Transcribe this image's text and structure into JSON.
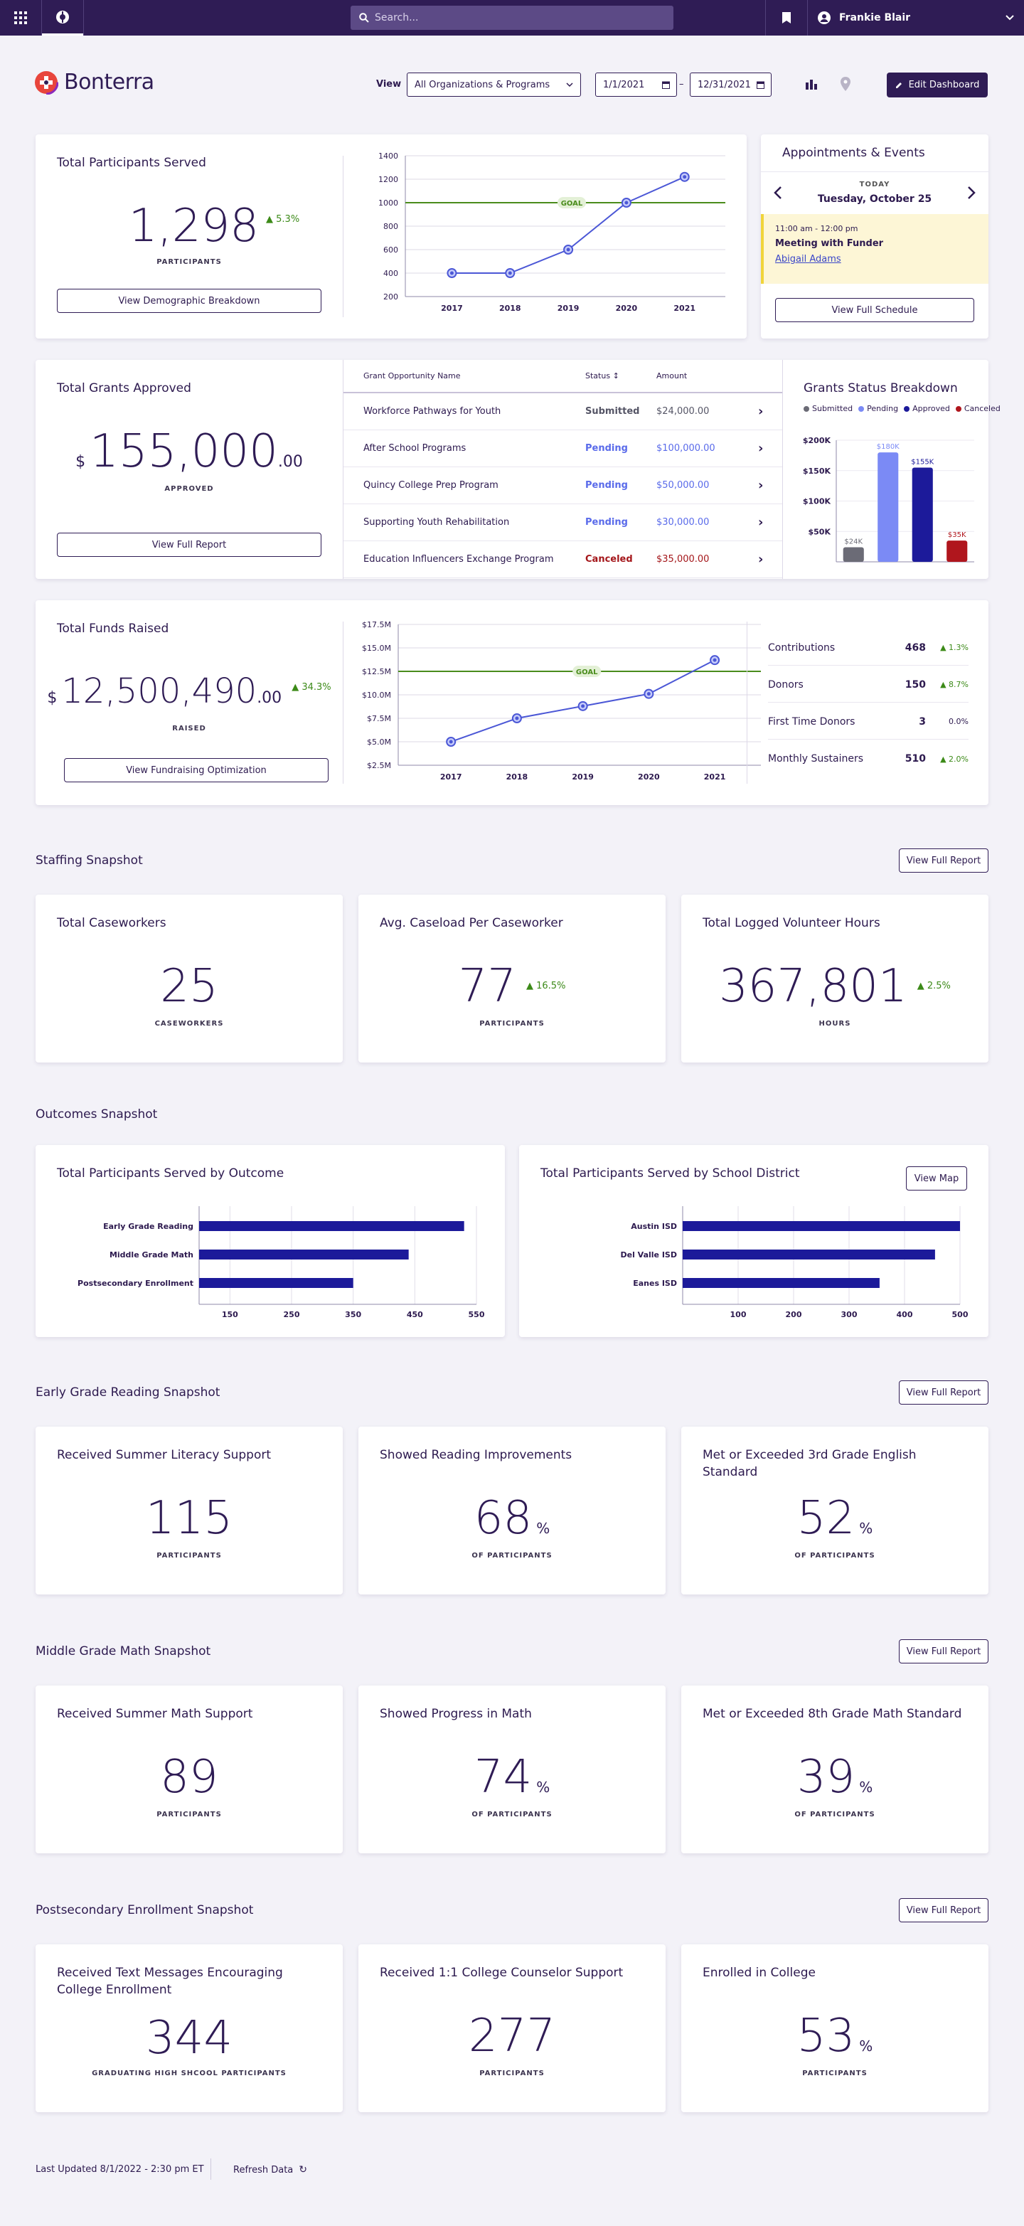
{
  "topbar": {
    "search_placeholder": "Search...",
    "user_name": "Frankie Blair"
  },
  "header": {
    "brand": "Bonterra",
    "view_label": "View",
    "view_value": "All Organizations & Programs",
    "date_from": "1/1/2021",
    "date_to": "12/31/2021",
    "date_sep": "–",
    "edit_label": "Edit Dashboard"
  },
  "participants": {
    "title": "Total Participants Served",
    "value": "1,298",
    "delta": "5.3%",
    "caption": "PARTICIPANTS",
    "button": "View Demographic Breakdown",
    "chart_data": {
      "type": "line",
      "x": [
        "2017",
        "2018",
        "2019",
        "2020",
        "2021"
      ],
      "values": [
        400,
        400,
        600,
        1000,
        1220
      ],
      "goal": 1000,
      "goal_label": "GOAL",
      "ylim": [
        200,
        1400
      ],
      "yticks": [
        "200",
        "400",
        "600",
        "800",
        "1000",
        "1200",
        "1400"
      ],
      "color": "#4b57d6",
      "goal_color": "#4a8c1c"
    }
  },
  "appointments": {
    "title": "Appointments & Events",
    "day_label": "TODAY",
    "date": "Tuesday, October 25",
    "time": "11:00 am - 12:00 pm",
    "event": "Meeting with Funder",
    "person": "Abigail Adams",
    "button": "View Full Schedule"
  },
  "grants": {
    "title": "Total Grants Approved",
    "currency": "$",
    "value": "155,000",
    "cents": ".00",
    "caption": "APPROVED",
    "button": "View Full Report",
    "columns": {
      "name": "Grant Opportunity Name",
      "status": "Status",
      "amount": "Amount"
    },
    "rows": [
      {
        "name": "Workforce Pathways for Youth",
        "status": "Submitted",
        "amount": "$24,000.00",
        "color": "#555566"
      },
      {
        "name": "After School Programs",
        "status": "Pending",
        "amount": "$100,000.00",
        "color": "#5a6bea"
      },
      {
        "name": "Quincy College Prep Program",
        "status": "Pending",
        "amount": "$50,000.00",
        "color": "#5a6bea"
      },
      {
        "name": "Supporting Youth Rehabilitation",
        "status": "Pending",
        "amount": "$30,000.00",
        "color": "#5a6bea"
      },
      {
        "name": "Education Influencers Exchange Program",
        "status": "Canceled",
        "amount": "$35,000.00",
        "color": "#a4161a"
      }
    ]
  },
  "grants_breakdown": {
    "title": "Grants Status Breakdown",
    "chart_data": {
      "type": "bar",
      "categories": [
        "Submitted",
        "Pending",
        "Approved",
        "Canceled"
      ],
      "values": [
        24,
        180,
        155,
        35
      ],
      "labels": [
        "$24K",
        "$180K",
        "$155K",
        "$35K"
      ],
      "colors": [
        "#6b6b76",
        "#7b8af5",
        "#1c1a9a",
        "#b0161d"
      ],
      "ylim": [
        0,
        200
      ],
      "yticks": [
        "$50K",
        "$100K",
        "$150K",
        "$200K"
      ]
    }
  },
  "funds": {
    "title": "Total Funds Raised",
    "currency": "$",
    "value": "12,500,490",
    "cents": ".00",
    "delta": "34.3%",
    "caption": "RAISED",
    "button": "View Fundraising Optimization",
    "chart_data": {
      "type": "line",
      "x": [
        "2017",
        "2018",
        "2019",
        "2020",
        "2021"
      ],
      "values": [
        5.0,
        7.5,
        8.8,
        10.1,
        13.7
      ],
      "goal": 12.5,
      "goal_label": "GOAL",
      "ylim": [
        2.5,
        17.5
      ],
      "yticks": [
        "$2.5M",
        "$5.0M",
        "$7.5M",
        "$10.0M",
        "$12.5M",
        "$15.0M",
        "$17.5M"
      ],
      "color": "#4b57d6",
      "goal_color": "#4a8c1c"
    },
    "metrics": [
      {
        "label": "Contributions",
        "value": "468",
        "delta": "1.3%",
        "up": true
      },
      {
        "label": "Donors",
        "value": "150",
        "delta": "8.7%",
        "up": true
      },
      {
        "label": "First Time Donors",
        "value": "3",
        "delta": "0.0%",
        "up": false
      },
      {
        "label": "Monthly Sustainers",
        "value": "510",
        "delta": "2.0%",
        "up": true
      }
    ]
  },
  "staffing": {
    "title": "Staffing Snapshot",
    "button": "View Full Report",
    "cards": [
      {
        "title": "Total Caseworkers",
        "value": "25",
        "caption": "CASEWORKERS",
        "delta": ""
      },
      {
        "title": "Avg. Caseload Per Caseworker",
        "value": "77",
        "caption": "PARTICIPANTS",
        "delta": "16.5%"
      },
      {
        "title": "Total Logged Volunteer Hours",
        "value": "367,801",
        "caption": "HOURS",
        "delta": "2.5%"
      }
    ]
  },
  "outcomes": {
    "title": "Outcomes Snapshot",
    "by_outcome": {
      "title": "Total Participants Served by Outcome",
      "chart_data": {
        "type": "bar",
        "orientation": "horizontal",
        "categories": [
          "Early Grade Reading",
          "Middle Grade Math",
          "Postsecondary Enrollment"
        ],
        "values": [
          530,
          440,
          350
        ],
        "xlim": [
          100,
          550
        ],
        "xticks": [
          "150",
          "250",
          "350",
          "450",
          "550"
        ],
        "color": "#1c1a9a"
      }
    },
    "by_district": {
      "title": "Total Participants Served by School District",
      "button": "View Map",
      "chart_data": {
        "type": "bar",
        "orientation": "horizontal",
        "categories": [
          "Austin ISD",
          "Del Valle ISD",
          "Eanes ISD"
        ],
        "values": [
          500,
          455,
          355
        ],
        "xlim": [
          0,
          500
        ],
        "xticks": [
          "100",
          "200",
          "300",
          "400",
          "500"
        ],
        "color": "#1c1a9a"
      }
    }
  },
  "reading": {
    "title": "Early Grade Reading Snapshot",
    "button": "View Full Report",
    "cards": [
      {
        "title": "Received Summer Literacy Support",
        "value": "115",
        "unit": "",
        "caption": "PARTICIPANTS"
      },
      {
        "title": "Showed Reading Improvements",
        "value": "68",
        "unit": "%",
        "caption": "OF PARTICIPANTS"
      },
      {
        "title": "Met or Exceeded 3rd Grade English Standard",
        "value": "52",
        "unit": "%",
        "caption": "OF PARTICIPANTS"
      }
    ]
  },
  "math": {
    "title": "Middle Grade Math Snapshot",
    "button": "View Full Report",
    "cards": [
      {
        "title": "Received Summer Math Support",
        "value": "89",
        "unit": "",
        "caption": "PARTICIPANTS"
      },
      {
        "title": "Showed Progress in Math",
        "value": "74",
        "unit": "%",
        "caption": "OF PARTICIPANTS"
      },
      {
        "title": "Met or Exceeded 8th Grade Math Standard",
        "value": "39",
        "unit": "%",
        "caption": "OF PARTICIPANTS"
      }
    ]
  },
  "postsecondary": {
    "title": "Postsecondary Enrollment Snapshot",
    "button": "View Full Report",
    "cards": [
      {
        "title": "Received Text Messages Encouraging College Enrollment",
        "value": "344",
        "unit": "",
        "caption": "GRADUATING HIGH SHCOOL PARTICIPANTS"
      },
      {
        "title": "Received 1:1 College Counselor Support",
        "value": "277",
        "unit": "",
        "caption": "PARTICIPANTS"
      },
      {
        "title": "Enrolled in College",
        "value": "53",
        "unit": "%",
        "caption": "PARTICIPANTS"
      }
    ]
  },
  "footer": {
    "updated": "Last Updated 8/1/2022 - 2:30 pm ET",
    "refresh": "Refresh Data"
  }
}
